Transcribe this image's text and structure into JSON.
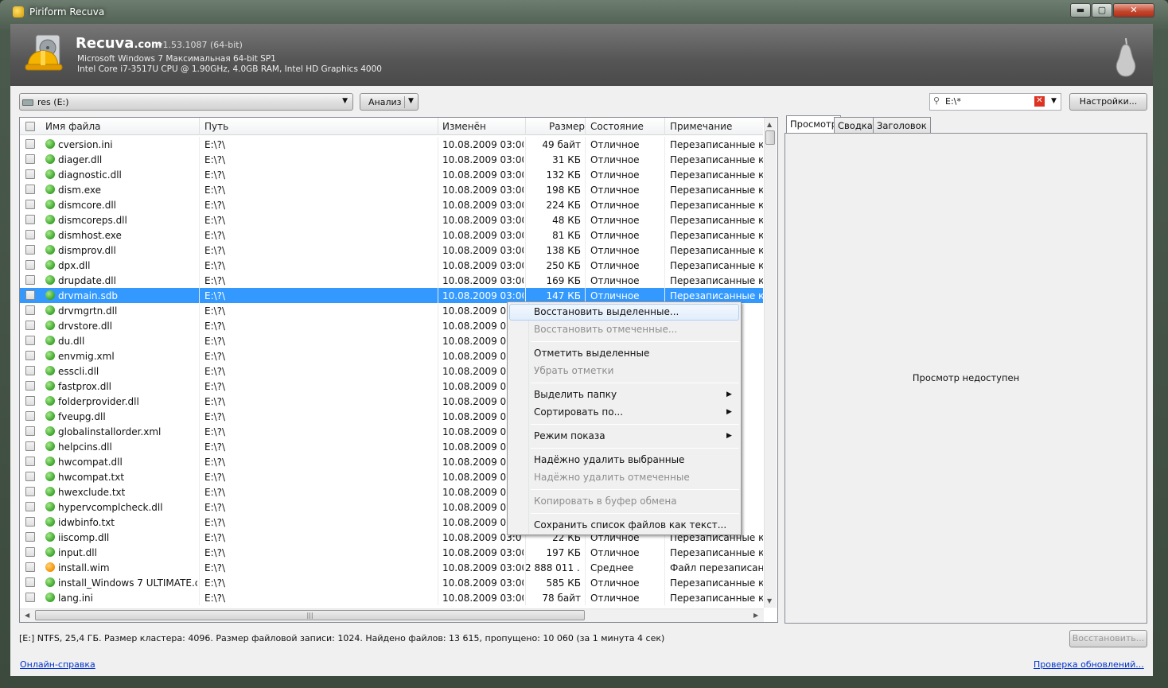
{
  "window": {
    "title": "Piriform Recuva",
    "min": "▬",
    "max": "▢",
    "close": "✕"
  },
  "header": {
    "app_name": "Recuva",
    "app_domain": ".com",
    "version": "v1.53.1087 (64-bit)",
    "os": "Microsoft Windows 7 Максимальная 64-bit SP1",
    "hardware": "Intel Core i7-3517U CPU @ 1.90GHz, 4.0GB RAM, Intel HD Graphics 4000"
  },
  "toolbar": {
    "drive": "res (E:)",
    "scan_label": "Анализ",
    "filter_value": "E:\\*",
    "settings_label": "Настройки..."
  },
  "columns": {
    "name": "Имя файла",
    "path": "Путь",
    "modified": "Изменён",
    "size": "Размер",
    "state": "Состояние",
    "comment": "Примечание"
  },
  "files": [
    {
      "name": "cversion.ini",
      "path": "E:\\?\\",
      "modified": "10.08.2009 03:00",
      "size": "49 байт",
      "state": "Отличное",
      "comment": "Перезаписанные кла",
      "status": "green"
    },
    {
      "name": "diager.dll",
      "path": "E:\\?\\",
      "modified": "10.08.2009 03:00",
      "size": "31 КБ",
      "state": "Отличное",
      "comment": "Перезаписанные кла",
      "status": "green"
    },
    {
      "name": "diagnostic.dll",
      "path": "E:\\?\\",
      "modified": "10.08.2009 03:00",
      "size": "132 КБ",
      "state": "Отличное",
      "comment": "Перезаписанные кла",
      "status": "green"
    },
    {
      "name": "dism.exe",
      "path": "E:\\?\\",
      "modified": "10.08.2009 03:00",
      "size": "198 КБ",
      "state": "Отличное",
      "comment": "Перезаписанные кла",
      "status": "green"
    },
    {
      "name": "dismcore.dll",
      "path": "E:\\?\\",
      "modified": "10.08.2009 03:00",
      "size": "224 КБ",
      "state": "Отличное",
      "comment": "Перезаписанные кла",
      "status": "green"
    },
    {
      "name": "dismcoreps.dll",
      "path": "E:\\?\\",
      "modified": "10.08.2009 03:00",
      "size": "48 КБ",
      "state": "Отличное",
      "comment": "Перезаписанные кла",
      "status": "green"
    },
    {
      "name": "dismhost.exe",
      "path": "E:\\?\\",
      "modified": "10.08.2009 03:00",
      "size": "81 КБ",
      "state": "Отличное",
      "comment": "Перезаписанные кла",
      "status": "green"
    },
    {
      "name": "dismprov.dll",
      "path": "E:\\?\\",
      "modified": "10.08.2009 03:00",
      "size": "138 КБ",
      "state": "Отличное",
      "comment": "Перезаписанные кла",
      "status": "green"
    },
    {
      "name": "dpx.dll",
      "path": "E:\\?\\",
      "modified": "10.08.2009 03:00",
      "size": "250 КБ",
      "state": "Отличное",
      "comment": "Перезаписанные кла",
      "status": "green"
    },
    {
      "name": "drupdate.dll",
      "path": "E:\\?\\",
      "modified": "10.08.2009 03:00",
      "size": "169 КБ",
      "state": "Отличное",
      "comment": "Перезаписанные кла",
      "status": "green"
    },
    {
      "name": "drvmain.sdb",
      "path": "E:\\?\\",
      "modified": "10.08.2009 03:00",
      "size": "147 КБ",
      "state": "Отличное",
      "comment": "Перезаписанные кла",
      "status": "green",
      "selected": true
    },
    {
      "name": "drvmgrtn.dll",
      "path": "E:\\?\\",
      "modified": "10.08.2009 03:0",
      "size": "",
      "state": "",
      "comment": "кла",
      "status": "green"
    },
    {
      "name": "drvstore.dll",
      "path": "E:\\?\\",
      "modified": "10.08.2009 03:0",
      "size": "",
      "state": "",
      "comment": "кла",
      "status": "green"
    },
    {
      "name": "du.dll",
      "path": "E:\\?\\",
      "modified": "10.08.2009 03:0",
      "size": "",
      "state": "",
      "comment": "кла",
      "status": "green"
    },
    {
      "name": "envmig.xml",
      "path": "E:\\?\\",
      "modified": "10.08.2009 03:0",
      "size": "",
      "state": "",
      "comment": "кла",
      "status": "green"
    },
    {
      "name": "esscli.dll",
      "path": "E:\\?\\",
      "modified": "10.08.2009 03:0",
      "size": "",
      "state": "",
      "comment": "кла",
      "status": "green"
    },
    {
      "name": "fastprox.dll",
      "path": "E:\\?\\",
      "modified": "10.08.2009 03:0",
      "size": "",
      "state": "",
      "comment": "кла",
      "status": "green"
    },
    {
      "name": "folderprovider.dll",
      "path": "E:\\?\\",
      "modified": "10.08.2009 03:0",
      "size": "",
      "state": "",
      "comment": "кла",
      "status": "green"
    },
    {
      "name": "fveupg.dll",
      "path": "E:\\?\\",
      "modified": "10.08.2009 03:0",
      "size": "",
      "state": "",
      "comment": "кла",
      "status": "green"
    },
    {
      "name": "globalinstallorder.xml",
      "path": "E:\\?\\",
      "modified": "10.08.2009 03:0",
      "size": "",
      "state": "",
      "comment": "кла",
      "status": "green"
    },
    {
      "name": "helpcins.dll",
      "path": "E:\\?\\",
      "modified": "10.08.2009 03:0",
      "size": "",
      "state": "",
      "comment": "кла",
      "status": "green"
    },
    {
      "name": "hwcompat.dll",
      "path": "E:\\?\\",
      "modified": "10.08.2009 03:0",
      "size": "",
      "state": "",
      "comment": "кла",
      "status": "green"
    },
    {
      "name": "hwcompat.txt",
      "path": "E:\\?\\",
      "modified": "10.08.2009 03:0",
      "size": "",
      "state": "",
      "comment": "кла",
      "status": "green"
    },
    {
      "name": "hwexclude.txt",
      "path": "E:\\?\\",
      "modified": "10.08.2009 03:0",
      "size": "",
      "state": "",
      "comment": "кла",
      "status": "green"
    },
    {
      "name": "hypervcomplcheck.dll",
      "path": "E:\\?\\",
      "modified": "10.08.2009 03:0",
      "size": "",
      "state": "",
      "comment": "кла",
      "status": "green"
    },
    {
      "name": "idwbinfo.txt",
      "path": "E:\\?\\",
      "modified": "10.08.2009 03:0",
      "size": "",
      "state": "",
      "comment": "кла",
      "status": "green"
    },
    {
      "name": "iiscomp.dll",
      "path": "E:\\?\\",
      "modified": "10.08.2009 03:0",
      "size": "22 КБ",
      "state": "Отличное",
      "comment": "Перезаписанные кла",
      "status": "green"
    },
    {
      "name": "input.dll",
      "path": "E:\\?\\",
      "modified": "10.08.2009 03:00",
      "size": "197 КБ",
      "state": "Отличное",
      "comment": "Перезаписанные кла",
      "status": "green"
    },
    {
      "name": "install.wim",
      "path": "E:\\?\\",
      "modified": "10.08.2009 03:00",
      "size": "2 888 011 ...",
      "state": "Среднее",
      "comment": "Файл перезаписан с ı",
      "status": "orange"
    },
    {
      "name": "install_Windows 7 ULTIMATE.clg",
      "path": "E:\\?\\",
      "modified": "10.08.2009 03:00",
      "size": "585 КБ",
      "state": "Отличное",
      "comment": "Перезаписанные кла",
      "status": "green"
    },
    {
      "name": "lang.ini",
      "path": "E:\\?\\",
      "modified": "10.08.2009 03:00",
      "size": "78 байт",
      "state": "Отличное",
      "comment": "Перезаписанные кла",
      "status": "green"
    }
  ],
  "context_menu": {
    "restore_selected": "Восстановить выделенные...",
    "restore_checked": "Восстановить отмеченные...",
    "check_selected": "Отметить выделенные",
    "uncheck": "Убрать отметки",
    "select_folder": "Выделить папку",
    "sort_by": "Сортировать по...",
    "view_mode": "Режим показа",
    "secure_delete_selected": "Надёжно удалить выбранные",
    "secure_delete_checked": "Надёжно удалить отмеченные",
    "copy_clipboard": "Копировать в буфер обмена",
    "save_list": "Сохранить список файлов как текст..."
  },
  "preview": {
    "tab_preview": "Просмотр",
    "tab_summary": "Сводка",
    "tab_header": "Заголовок",
    "message": "Просмотр недоступен"
  },
  "status": {
    "text": "[E:] NTFS, 25,4 ГБ. Размер кластера: 4096. Размер файловой записи: 1024. Найдено файлов: 13 615, пропущено: 10 060 (за 1 минута 4 сек)",
    "restore_label": "Восстановить..."
  },
  "footer": {
    "help": "Онлайн-справка",
    "updates": "Проверка обновлений..."
  }
}
